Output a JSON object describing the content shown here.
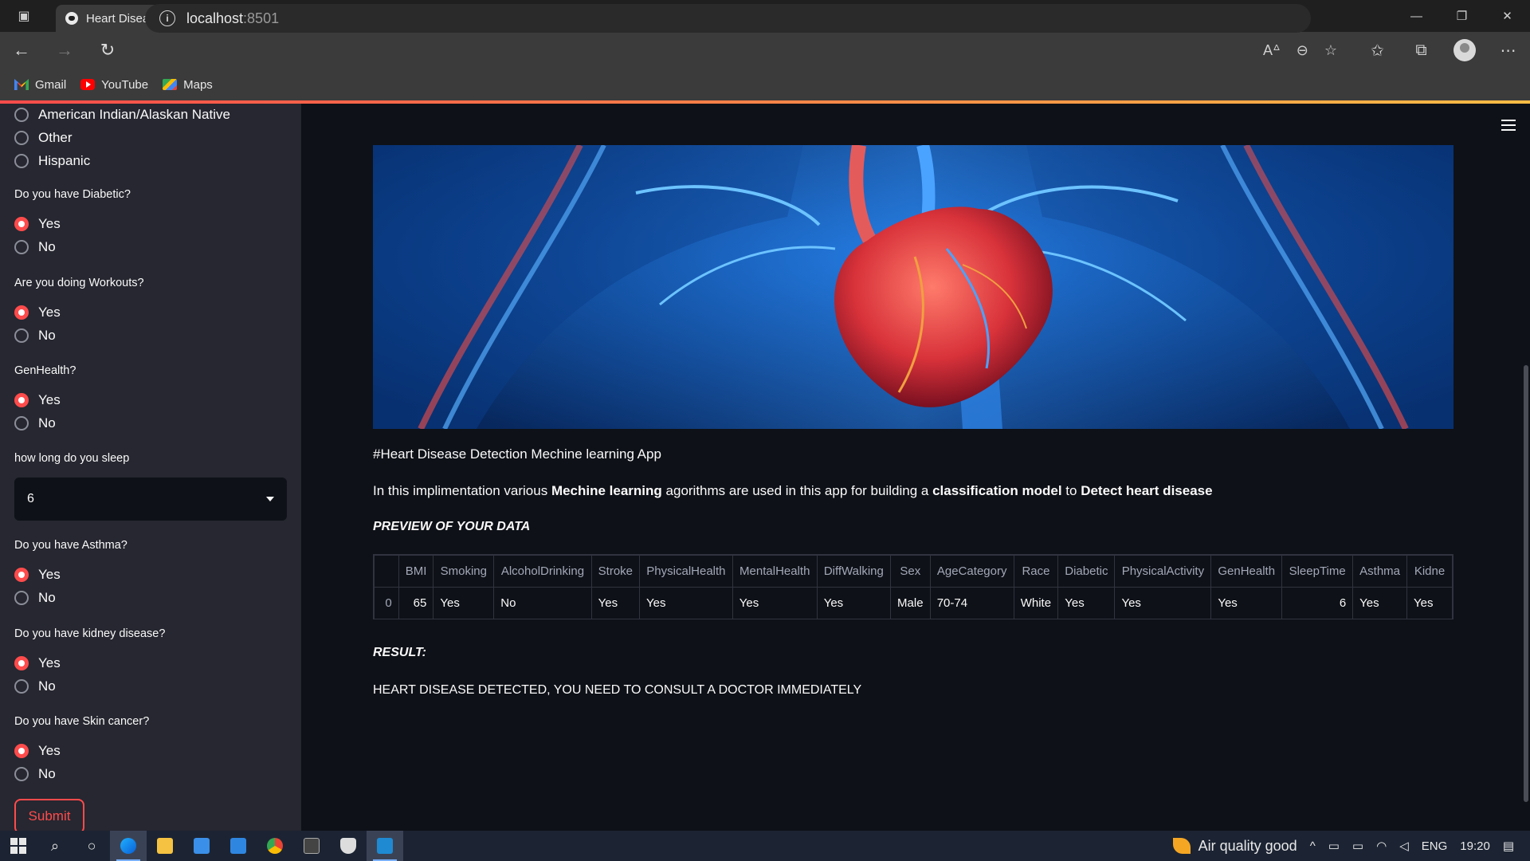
{
  "browser": {
    "tab_title": "Heart Disease Detection Mechine learning App",
    "url_host": "localhost",
    "url_port": ":8501",
    "bookmarks": [
      {
        "label": "Gmail",
        "icon": "gmail-icon"
      },
      {
        "label": "YouTube",
        "icon": "youtube-icon"
      },
      {
        "label": "Maps",
        "icon": "maps-icon"
      }
    ]
  },
  "sidebar": {
    "race_options": [
      "American Indian/Alaskan Native",
      "Other",
      "Hispanic"
    ],
    "questions": [
      {
        "label": "Do you have Diabetic?",
        "options": [
          "Yes",
          "No"
        ],
        "selected": "Yes"
      },
      {
        "label": "Are you doing Workouts?",
        "options": [
          "Yes",
          "No"
        ],
        "selected": "Yes"
      },
      {
        "label": "GenHealth?",
        "options": [
          "Yes",
          "No"
        ],
        "selected": "Yes"
      },
      {
        "label": "how long do you sleep",
        "type": "select",
        "value": "6"
      },
      {
        "label": "Do you have Asthma?",
        "options": [
          "Yes",
          "No"
        ],
        "selected": "Yes"
      },
      {
        "label": "Do you have kidney disease?",
        "options": [
          "Yes",
          "No"
        ],
        "selected": "Yes"
      },
      {
        "label": "Do you have Skin cancer?",
        "options": [
          "Yes",
          "No"
        ],
        "selected": "Yes"
      }
    ],
    "submit_label": "Submit"
  },
  "main": {
    "app_line": "#Heart Disease Detection Mechine learning App",
    "desc": {
      "p1": "In this implimentation various ",
      "b1": "Mechine learning",
      "p2": " agorithms are used in this app for building a ",
      "b2": "classification model",
      "p3": " to ",
      "b3": "Detect heart disease"
    },
    "preview_heading": "PREVIEW OF YOUR DATA",
    "table": {
      "columns": [
        "",
        "BMI",
        "Smoking",
        "AlcoholDrinking",
        "Stroke",
        "PhysicalHealth",
        "MentalHealth",
        "DiffWalking",
        "Sex",
        "AgeCategory",
        "Race",
        "Diabetic",
        "PhysicalActivity",
        "GenHealth",
        "SleepTime",
        "Asthma",
        "Kidne"
      ],
      "row": [
        "0",
        "65",
        "Yes",
        "No",
        "Yes",
        "Yes",
        "Yes",
        "Yes",
        "Male",
        "70-74",
        "White",
        "Yes",
        "Yes",
        "Yes",
        "6",
        "Yes",
        "Yes"
      ]
    },
    "result_heading": "RESULT:",
    "result_text": "HEART DISEASE DETECTED, YOU NEED TO CONSULT A DOCTOR IMMEDIATELY"
  },
  "taskbar": {
    "air_quality": "Air quality good",
    "language": "ENG",
    "time": "19:20"
  },
  "colors": {
    "accent": "#ff4b4b",
    "sidebar_bg": "#262730",
    "main_bg": "#0e1117"
  }
}
